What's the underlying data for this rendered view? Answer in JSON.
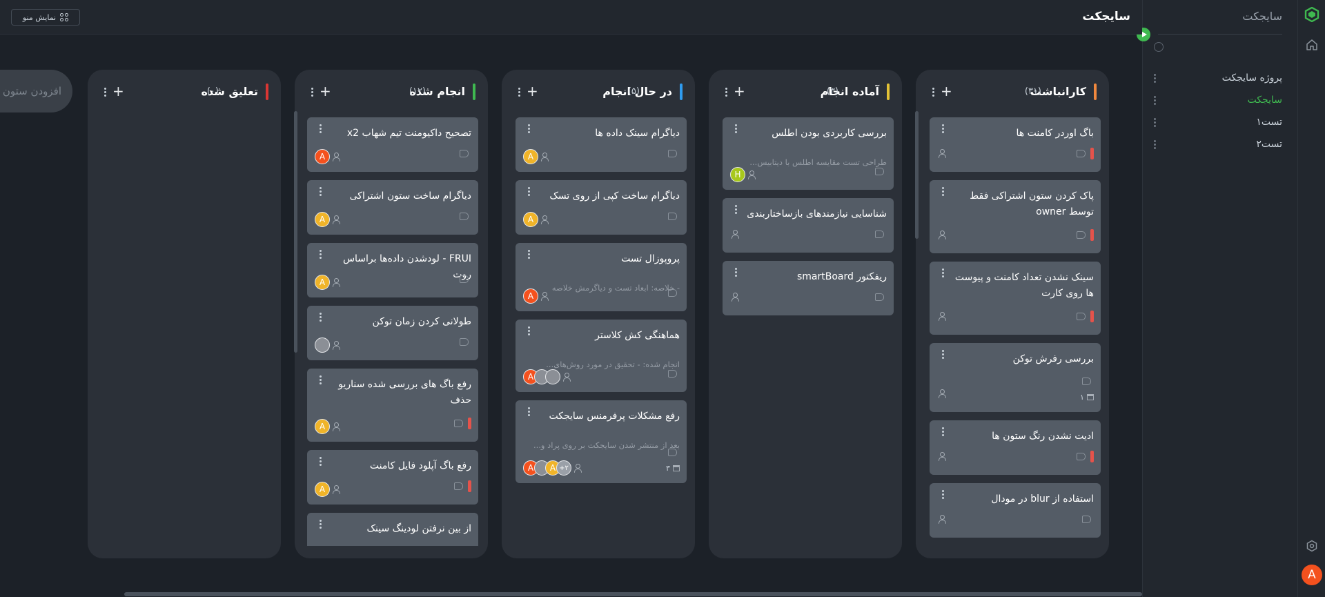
{
  "app": {
    "name": "سایجکت",
    "board_title": "سایجکت"
  },
  "topbar": {
    "menu_button": "نمایش منو"
  },
  "sidebar": {
    "title": "سایجکت",
    "items": [
      {
        "label": "پروژه سایجکت",
        "active": false
      },
      {
        "label": "سایجکت",
        "active": true
      },
      {
        "label": "تست۱",
        "active": false
      },
      {
        "label": "تست۲",
        "active": false
      }
    ]
  },
  "add_column_label": "+ افزودن ستون",
  "colors": {
    "accent": "#3fb950",
    "backlog": "#f0883e",
    "ready": "#e3c236",
    "doing": "#2f9cf0",
    "done": "#3fb950",
    "blocked": "#da3633",
    "priority": "#e5534b"
  },
  "columns": [
    {
      "name": "کارانباشت",
      "count": "(۳۱)",
      "cards": [
        {
          "title": "باگ اوردر کامنت ها",
          "desc": "",
          "assignees": [],
          "priority": true
        },
        {
          "title": "پاک کردن ستون اشتراکی فقط توسط owner",
          "desc": "",
          "assignees": [],
          "priority": true
        },
        {
          "title": "سینک نشدن تعداد کامنت و پیوست ها روی کارت",
          "desc": "",
          "assignees": [],
          "priority": true
        },
        {
          "title": "بررسی رفرش توکن",
          "desc": "",
          "assignees": [],
          "priority": false,
          "meta": "۱"
        },
        {
          "title": "ادیت نشدن رنگ ستون ها",
          "desc": "",
          "assignees": [],
          "priority": true
        },
        {
          "title": "استفاده از blur در مودال",
          "desc": "",
          "assignees": [],
          "priority": false
        }
      ]
    },
    {
      "name": "آماده انجام",
      "count": "(۳)",
      "cards": [
        {
          "title": "بررسی کاربردی بودن اطلس",
          "desc": "طراحی تست مقایسه اطلس با دیتابیس...",
          "assignees": [
            "H"
          ],
          "priority": false
        },
        {
          "title": "شناسایی نیازمندهای بازساختاربندی",
          "desc": "",
          "assignees": [],
          "priority": false
        },
        {
          "title": "ریفکتور smartBoard",
          "desc": "",
          "assignees": [],
          "priority": false
        }
      ]
    },
    {
      "name": "در حال انجام",
      "count": "(۵)",
      "cards": [
        {
          "title": "دیاگرام سینک داده ها",
          "desc": "",
          "assignees": [
            "A"
          ],
          "priority": false
        },
        {
          "title": "دیاگرام ساخت کپی از روی تسک",
          "desc": "",
          "assignees": [
            "A"
          ],
          "priority": false
        },
        {
          "title": "پروپوزال تست",
          "desc": "- خلاصه: ابعاد تست و دیاگرمش خلاصه",
          "assignees": [
            "A"
          ],
          "priority": false
        },
        {
          "title": "هماهنگی کش کلاستر",
          "desc": "انجام شده: - تحقیق در مورد روش‌های...",
          "assignees": [
            "A",
            "img",
            "img"
          ],
          "priority": false
        },
        {
          "title": "رفع مشکلات پرفرمنس سایجکت",
          "desc": "بعد از منتشر شدن سایجکت بر روی پراد و...",
          "assignees": [
            "A",
            "img",
            "A",
            "+۲"
          ],
          "priority": false,
          "meta": "۳"
        }
      ]
    },
    {
      "name": "انجام شده",
      "count": "(۱۲)",
      "cards": [
        {
          "title": "تصحیح داکیومنت تیم شهاب x2",
          "desc": "",
          "assignees": [
            "A"
          ],
          "priority": false
        },
        {
          "title": "دیاگرام ساخت ستون اشتراکی",
          "desc": "",
          "assignees": [
            "A"
          ],
          "priority": false
        },
        {
          "title": "FRUI - لودشدن داده‌ها براساس روت",
          "desc": "",
          "assignees": [
            "A"
          ],
          "priority": false
        },
        {
          "title": "طولانی کردن زمان توکن",
          "desc": "",
          "assignees": [
            "img"
          ],
          "priority": false
        },
        {
          "title": "رفع باگ های بررسی شده سناریو حذف",
          "desc": "",
          "assignees": [
            "A"
          ],
          "priority": true
        },
        {
          "title": "رفع باگ آپلود فایل کامنت",
          "desc": "",
          "assignees": [
            "A"
          ],
          "priority": true
        },
        {
          "title": "از بین نرفتن لودینگ سینک",
          "desc": "",
          "assignees": [],
          "priority": false
        }
      ]
    },
    {
      "name": "تعلیق شده",
      "count": "(۰)",
      "cards": []
    }
  ]
}
